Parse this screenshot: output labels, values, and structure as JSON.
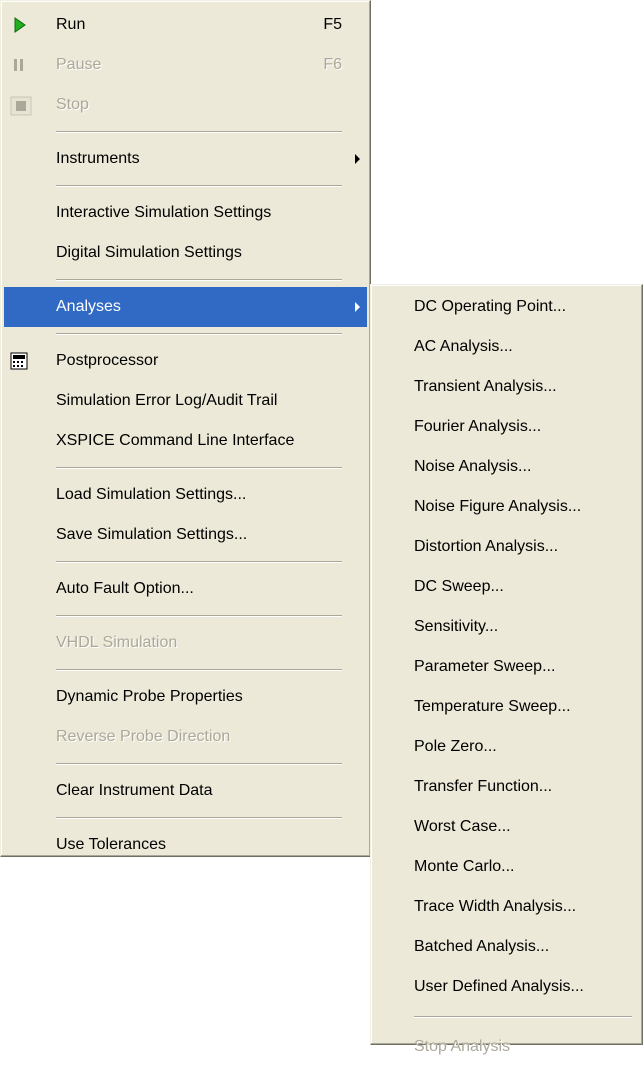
{
  "main_menu": {
    "items": [
      {
        "label": "Run",
        "shortcut": "F5",
        "icon": "run-play-icon"
      },
      {
        "label": "Pause",
        "shortcut": "F6",
        "icon": "pause-icon"
      },
      {
        "label": "Stop",
        "icon": "stop-icon"
      },
      {
        "label": "Instruments"
      },
      {
        "label": "Interactive Simulation Settings"
      },
      {
        "label": "Digital Simulation Settings"
      },
      {
        "label": "Analyses"
      },
      {
        "label": "Postprocessor",
        "icon": "postprocessor-icon"
      },
      {
        "label": "Simulation Error Log/Audit Trail"
      },
      {
        "label": "XSPICE Command Line Interface"
      },
      {
        "label": "Load Simulation Settings..."
      },
      {
        "label": "Save Simulation Settings..."
      },
      {
        "label": "Auto Fault Option..."
      },
      {
        "label": "VHDL Simulation"
      },
      {
        "label": "Dynamic Probe Properties"
      },
      {
        "label": "Reverse Probe Direction"
      },
      {
        "label": "Clear Instrument Data"
      },
      {
        "label": "Use Tolerances"
      }
    ]
  },
  "analyses_submenu": {
    "items": [
      {
        "label": "DC Operating Point..."
      },
      {
        "label": "AC Analysis..."
      },
      {
        "label": "Transient Analysis..."
      },
      {
        "label": "Fourier Analysis..."
      },
      {
        "label": "Noise Analysis..."
      },
      {
        "label": "Noise Figure Analysis..."
      },
      {
        "label": "Distortion Analysis..."
      },
      {
        "label": "DC Sweep..."
      },
      {
        "label": "Sensitivity..."
      },
      {
        "label": "Parameter Sweep..."
      },
      {
        "label": "Temperature Sweep..."
      },
      {
        "label": "Pole Zero..."
      },
      {
        "label": "Transfer Function..."
      },
      {
        "label": "Worst Case..."
      },
      {
        "label": "Monte Carlo..."
      },
      {
        "label": "Trace Width Analysis..."
      },
      {
        "label": "Batched Analysis..."
      },
      {
        "label": "User Defined Analysis..."
      },
      {
        "label": "Stop Analysis"
      }
    ]
  },
  "colors": {
    "menu_background": "#ece9d8",
    "highlight": "#316ac5",
    "disabled_text": "#aca899",
    "run_icon": "#22b022"
  }
}
